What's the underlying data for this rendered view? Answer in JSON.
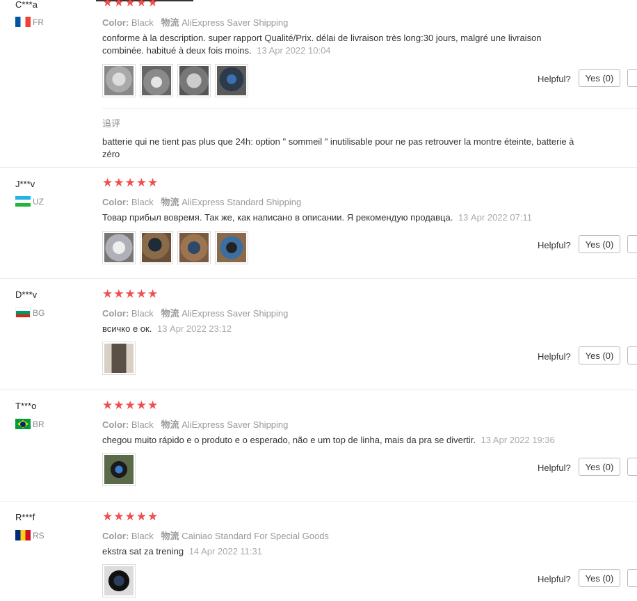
{
  "reviews": [
    {
      "user": "C***a",
      "country": "FR",
      "stars": "★★★★★",
      "color_label": "Color:",
      "color_value": "Black",
      "shipping_label": "物流",
      "shipping_value": "AliExpress Saver Shipping",
      "text": "conforme à la description. super rapport Qualité/Prix. délai de livraison très long:30 jours, malgré une livraison combinée. habitué à deux fois moins.",
      "date": "13 Apr 2022 10:04",
      "helpful": "Helpful?",
      "yes": "Yes (0)",
      "additional_label": "追评",
      "additional_text": "batterie qui ne tient pas plus que 24h: option \" sommeil \" inutilisable pour ne pas retrouver la montre éteinte, batterie à zéro"
    },
    {
      "user": "J***v",
      "country": "UZ",
      "stars": "★★★★★",
      "color_label": "Color:",
      "color_value": "Black",
      "shipping_label": "物流",
      "shipping_value": "AliExpress Standard Shipping",
      "text": "Товар прибыл вовремя. Так же, как написано в описании. Я рекомендую продавца.",
      "date": "13 Apr 2022 07:11",
      "helpful": "Helpful?",
      "yes": "Yes (0)"
    },
    {
      "user": "D***v",
      "country": "BG",
      "stars": "★★★★★",
      "color_label": "Color:",
      "color_value": "Black",
      "shipping_label": "物流",
      "shipping_value": "AliExpress Saver Shipping",
      "text": "всичко е ок.",
      "date": "13 Apr 2022 23:12",
      "helpful": "Helpful?",
      "yes": "Yes (0)"
    },
    {
      "user": "T***o",
      "country": "BR",
      "stars": "★★★★★",
      "color_label": "Color:",
      "color_value": "Black",
      "shipping_label": "物流",
      "shipping_value": "AliExpress Saver Shipping",
      "text": "chegou muito rápido e o produto e o esperado, não e um top de linha, mais da pra se divertir.",
      "date": "13 Apr 2022 19:36",
      "helpful": "Helpful?",
      "yes": "Yes (0)"
    },
    {
      "user": "R***f",
      "country": "RS",
      "stars": "★★★★★",
      "color_label": "Color:",
      "color_value": "Black",
      "shipping_label": "物流",
      "shipping_value": "Cainiao Standard For Special Goods",
      "text": "ekstra sat za trening",
      "date": "14 Apr 2022 11:31",
      "helpful": "Helpful?",
      "yes": "Yes (0)"
    }
  ]
}
